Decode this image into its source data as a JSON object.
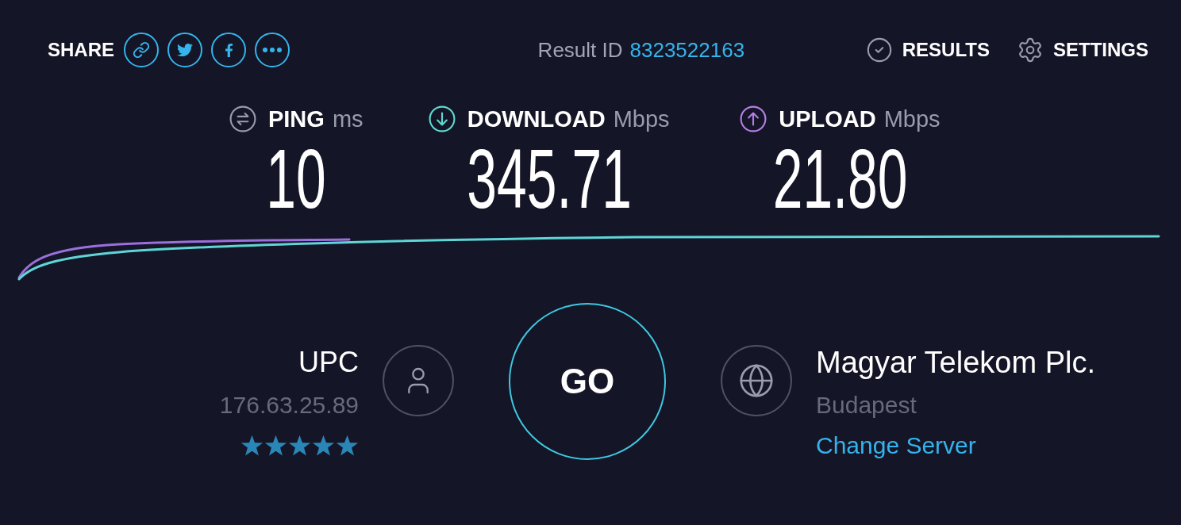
{
  "share": {
    "label": "SHARE"
  },
  "result": {
    "label": "Result ID",
    "id": "8323522163"
  },
  "nav": [
    {
      "kind": "results",
      "label": "RESULTS"
    },
    {
      "kind": "settings",
      "label": "SETTINGS"
    }
  ],
  "metrics": [
    {
      "kind": "ping",
      "label": "PING",
      "unit": "ms",
      "value": "10",
      "color": "#9a9bab"
    },
    {
      "kind": "download",
      "label": "DOWNLOAD",
      "unit": "Mbps",
      "value": "345.71",
      "color": "#5fd9cf"
    },
    {
      "kind": "upload",
      "label": "UPLOAD",
      "unit": "Mbps",
      "value": "21.80",
      "color": "#b57ee6"
    }
  ],
  "isp": {
    "name": "UPC",
    "ip": "176.63.25.89",
    "stars": 5
  },
  "go_button": {
    "label": "GO"
  },
  "server": {
    "name": "Magyar Telekom Plc.",
    "location": "Budapest",
    "change_link": "Change Server"
  }
}
